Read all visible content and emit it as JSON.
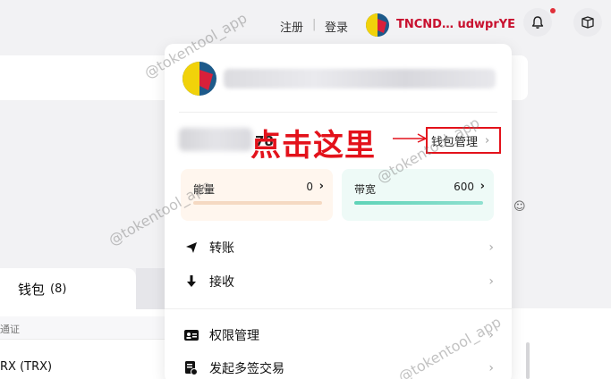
{
  "topbar": {
    "register": "注册",
    "separator": "|",
    "login": "登录",
    "account_name": "TNCND… udwprYE"
  },
  "background": {
    "wallet_tab_label": "钱包",
    "wallet_tab_count": "(8)",
    "column_header": "通证",
    "token_row": "RX (TRX)"
  },
  "panel": {
    "balance_suffix": "78",
    "annotation": "点击这里",
    "wallet_manage_label": "钱包管理",
    "energy": {
      "label": "能量",
      "value": "0"
    },
    "bandwidth": {
      "label": "带宽",
      "value": "600"
    },
    "menu": [
      {
        "label": "转账",
        "icon": "send-icon"
      },
      {
        "label": "接收",
        "icon": "download-icon"
      },
      {
        "label": "权限管理",
        "icon": "id-card-icon"
      },
      {
        "label": "发起多签交易",
        "icon": "multisig-icon"
      }
    ]
  },
  "watermark": "@tokentool_app",
  "colors": {
    "accent_red": "#e3121b",
    "account_red": "#c8102e",
    "notification_dot": "#e0303a",
    "bandwidth_bar": "#5fd3b8"
  }
}
